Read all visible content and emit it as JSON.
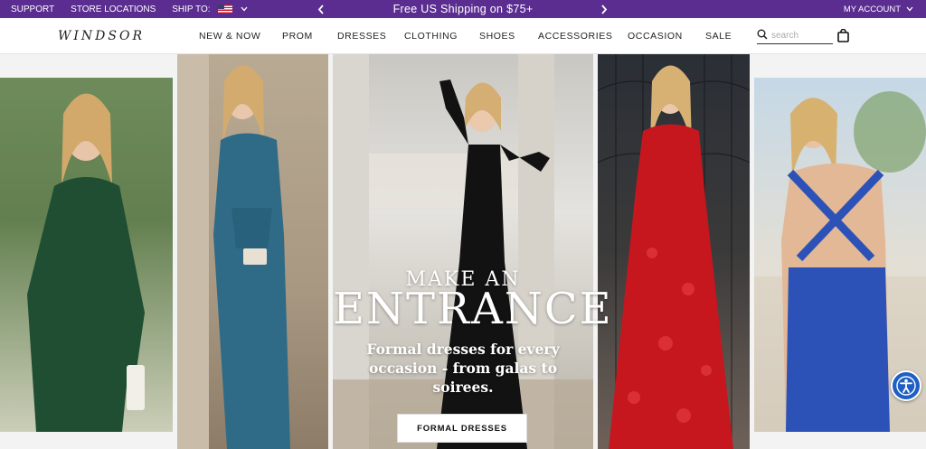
{
  "topbar": {
    "support": "SUPPORT",
    "store_locations": "STORE LOCATIONS",
    "ship_to": "SHIP TO:",
    "promo": "Free US Shipping on $75+",
    "my_account": "MY ACCOUNT"
  },
  "brand": {
    "logo": "WINDSOR"
  },
  "nav": {
    "items": [
      "NEW & NOW",
      "PROM",
      "DRESSES",
      "CLOTHING",
      "SHOES",
      "ACCESSORIES",
      "OCCASION",
      "SALE"
    ],
    "search_placeholder": "search"
  },
  "hero": {
    "line1": "MAKE AN",
    "line2": "ENTRANCE",
    "subtitle": "Formal dresses for every occasion - from galas to soirees.",
    "cta": "FORMAL DRESSES"
  },
  "colors": {
    "promo_bar": "#5b2d90",
    "accessibility": "#1f5fc4"
  },
  "icons": [
    "flag-us-icon",
    "chevron-down-icon",
    "chevron-left-icon",
    "chevron-right-icon",
    "search-icon",
    "shopping-bag-icon",
    "accessibility-icon"
  ]
}
